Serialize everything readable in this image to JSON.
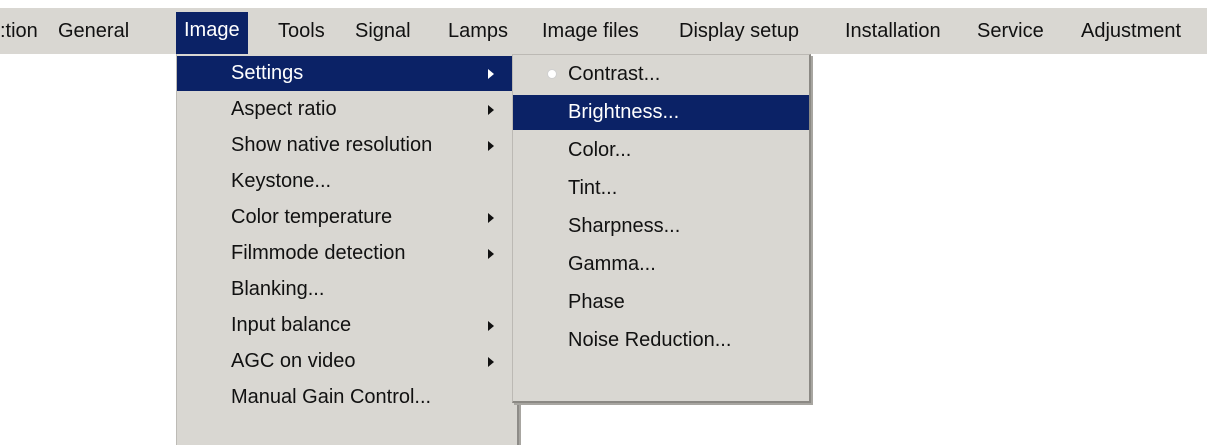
{
  "menubar": {
    "items": [
      {
        "label": ":tion",
        "active": false
      },
      {
        "label": "General",
        "active": false
      },
      {
        "label": "Image",
        "active": true
      },
      {
        "label": "Tools",
        "active": false
      },
      {
        "label": "Signal",
        "active": false
      },
      {
        "label": "Lamps",
        "active": false
      },
      {
        "label": "Image files",
        "active": false
      },
      {
        "label": "Display setup",
        "active": false
      },
      {
        "label": "Installation",
        "active": false
      },
      {
        "label": "Service",
        "active": false
      },
      {
        "label": "Adjustment",
        "active": false
      }
    ]
  },
  "image_menu": {
    "items": [
      {
        "label": "Settings",
        "has_submenu": true,
        "selected": true
      },
      {
        "label": "Aspect ratio",
        "has_submenu": true,
        "selected": false
      },
      {
        "label": "Show native resolution",
        "has_submenu": true,
        "selected": false
      },
      {
        "label": "Keystone...",
        "has_submenu": false,
        "selected": false
      },
      {
        "label": "Color temperature",
        "has_submenu": true,
        "selected": false
      },
      {
        "label": "Filmmode detection",
        "has_submenu": true,
        "selected": false
      },
      {
        "label": "Blanking...",
        "has_submenu": false,
        "selected": false
      },
      {
        "label": "Input balance",
        "has_submenu": true,
        "selected": false
      },
      {
        "label": "AGC on video",
        "has_submenu": true,
        "selected": false
      },
      {
        "label": "Manual Gain Control...",
        "has_submenu": false,
        "selected": false
      }
    ]
  },
  "settings_submenu": {
    "items": [
      {
        "label": "Contrast...",
        "selected": false,
        "radio": true
      },
      {
        "label": "Brightness...",
        "selected": true,
        "radio": false
      },
      {
        "label": "Color...",
        "selected": false,
        "radio": false
      },
      {
        "label": "Tint...",
        "selected": false,
        "radio": false
      },
      {
        "label": "Sharpness...",
        "selected": false,
        "radio": false
      },
      {
        "label": "Gamma...",
        "selected": false,
        "radio": false
      },
      {
        "label": "Phase",
        "selected": false,
        "radio": false
      },
      {
        "label": "Noise Reduction...",
        "selected": false,
        "radio": false
      }
    ]
  },
  "colors": {
    "menu_background": "#d9d7d2",
    "selection_background": "#0b2266",
    "selection_text": "#ffffff"
  }
}
